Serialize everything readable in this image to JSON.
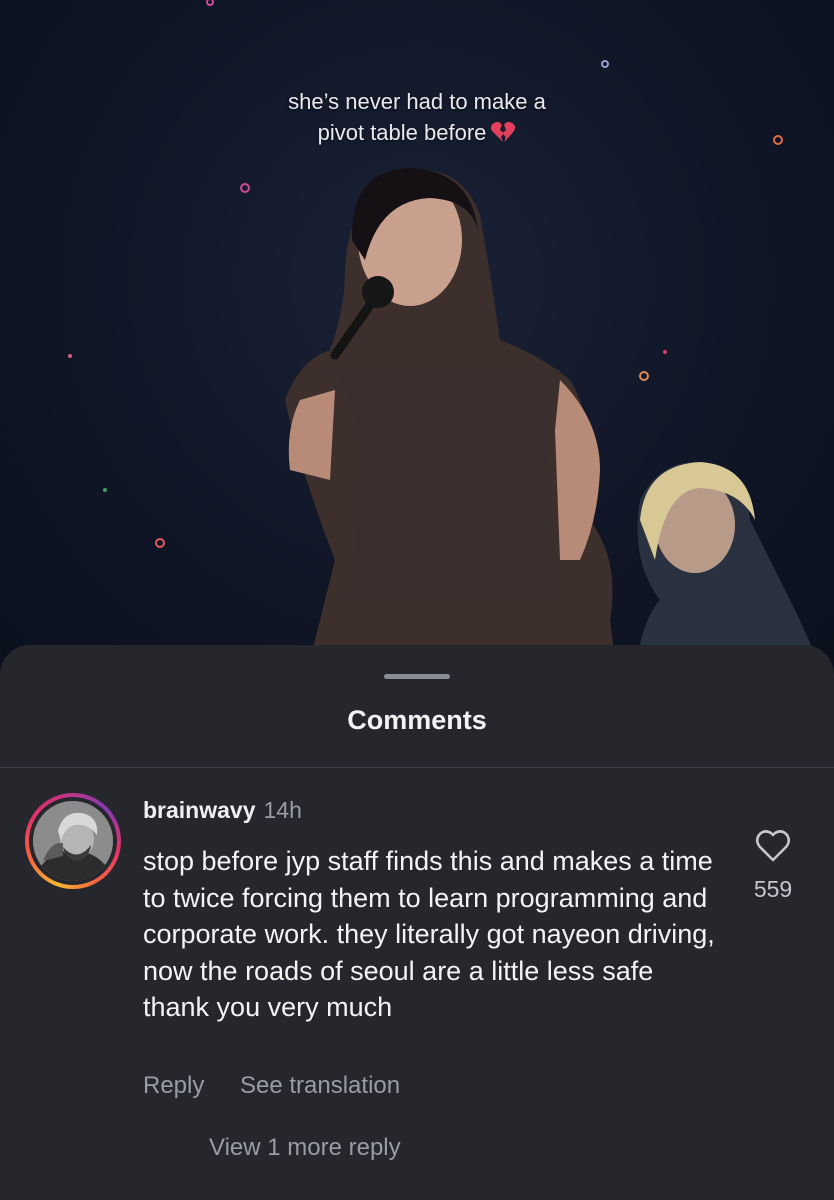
{
  "video": {
    "caption_line1": "she’s never had to make a",
    "caption_line2": "pivot table before",
    "caption_emoji": "broken-heart-icon"
  },
  "comments_sheet": {
    "title": "Comments",
    "comment": {
      "username": "brainwavy",
      "time": "14h",
      "text": "stop before jyp staff finds this and makes a time to twice forcing them to learn programming and corporate work. they literally got nayeon driving, now the roads of seoul are a little less safe thank you very much",
      "like_count": "559",
      "reply_label": "Reply",
      "translation_label": "See translation",
      "view_replies_label": "View 1 more reply"
    }
  },
  "colors": {
    "sheet_background": "#25272d",
    "story_ring": [
      "#f7b733",
      "#e1306c",
      "#833ab4"
    ]
  }
}
